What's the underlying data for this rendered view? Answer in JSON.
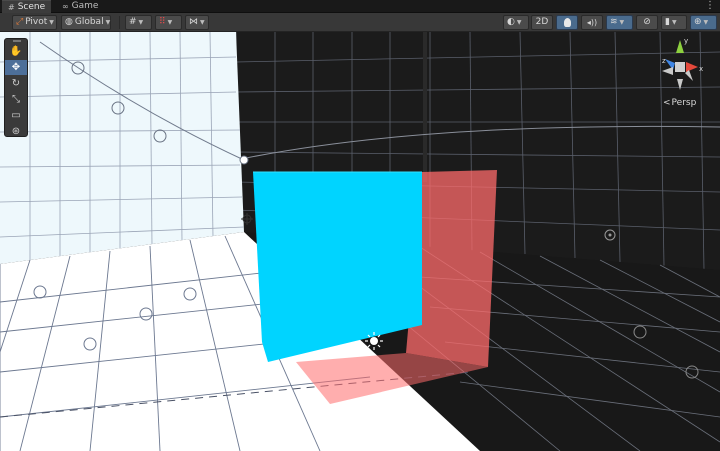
{
  "tabs": [
    {
      "label": "Scene",
      "icon": "hash-icon"
    },
    {
      "label": "Game",
      "icon": "gamepad-icon"
    }
  ],
  "tab_menu_icon": "⋮",
  "toolbar": {
    "pivot_label": "Pivot",
    "global_label": "Global",
    "mode_2d_label": "2D",
    "glyphs": {
      "pivot": "⤢",
      "global": "◍",
      "grid": "#",
      "snap": "⠿",
      "increment": "⋈",
      "shading": "◐",
      "lighting": "💡",
      "audio": "🔈",
      "effects": "≋",
      "visibility": "⊘",
      "camera": "▮",
      "gizmos": "⊕",
      "dropdown": "▼"
    }
  },
  "tools": [
    {
      "name": "hand-tool",
      "glyph": "✋"
    },
    {
      "name": "move-tool",
      "glyph": "✥"
    },
    {
      "name": "rotate-tool",
      "glyph": "↻"
    },
    {
      "name": "scale-tool",
      "glyph": "⤡"
    },
    {
      "name": "rect-tool",
      "glyph": "▭"
    },
    {
      "name": "transform-tool",
      "glyph": "⊛"
    }
  ],
  "gizmo": {
    "persp_label": "Persp",
    "persp_icon": "<",
    "axis_y": "y",
    "axis_z": "z",
    "axis_x": "x",
    "colors": {
      "y": "#8dd13f",
      "x": "#e5493b",
      "z": "#3f86e5",
      "neutral": "#c9c9c9"
    }
  },
  "scene": {
    "colors": {
      "cube_front": "#00d4ff",
      "transparent_plane": "#ff6b6b",
      "left_wall": "#e8f6fb",
      "right_wall": "#1c1c1c",
      "floor_light": "#ffffff",
      "floor_dark": "#1a1a1a",
      "grid_dark_line": "#3a4a66",
      "grid_light_line": "#aab2c0"
    }
  }
}
